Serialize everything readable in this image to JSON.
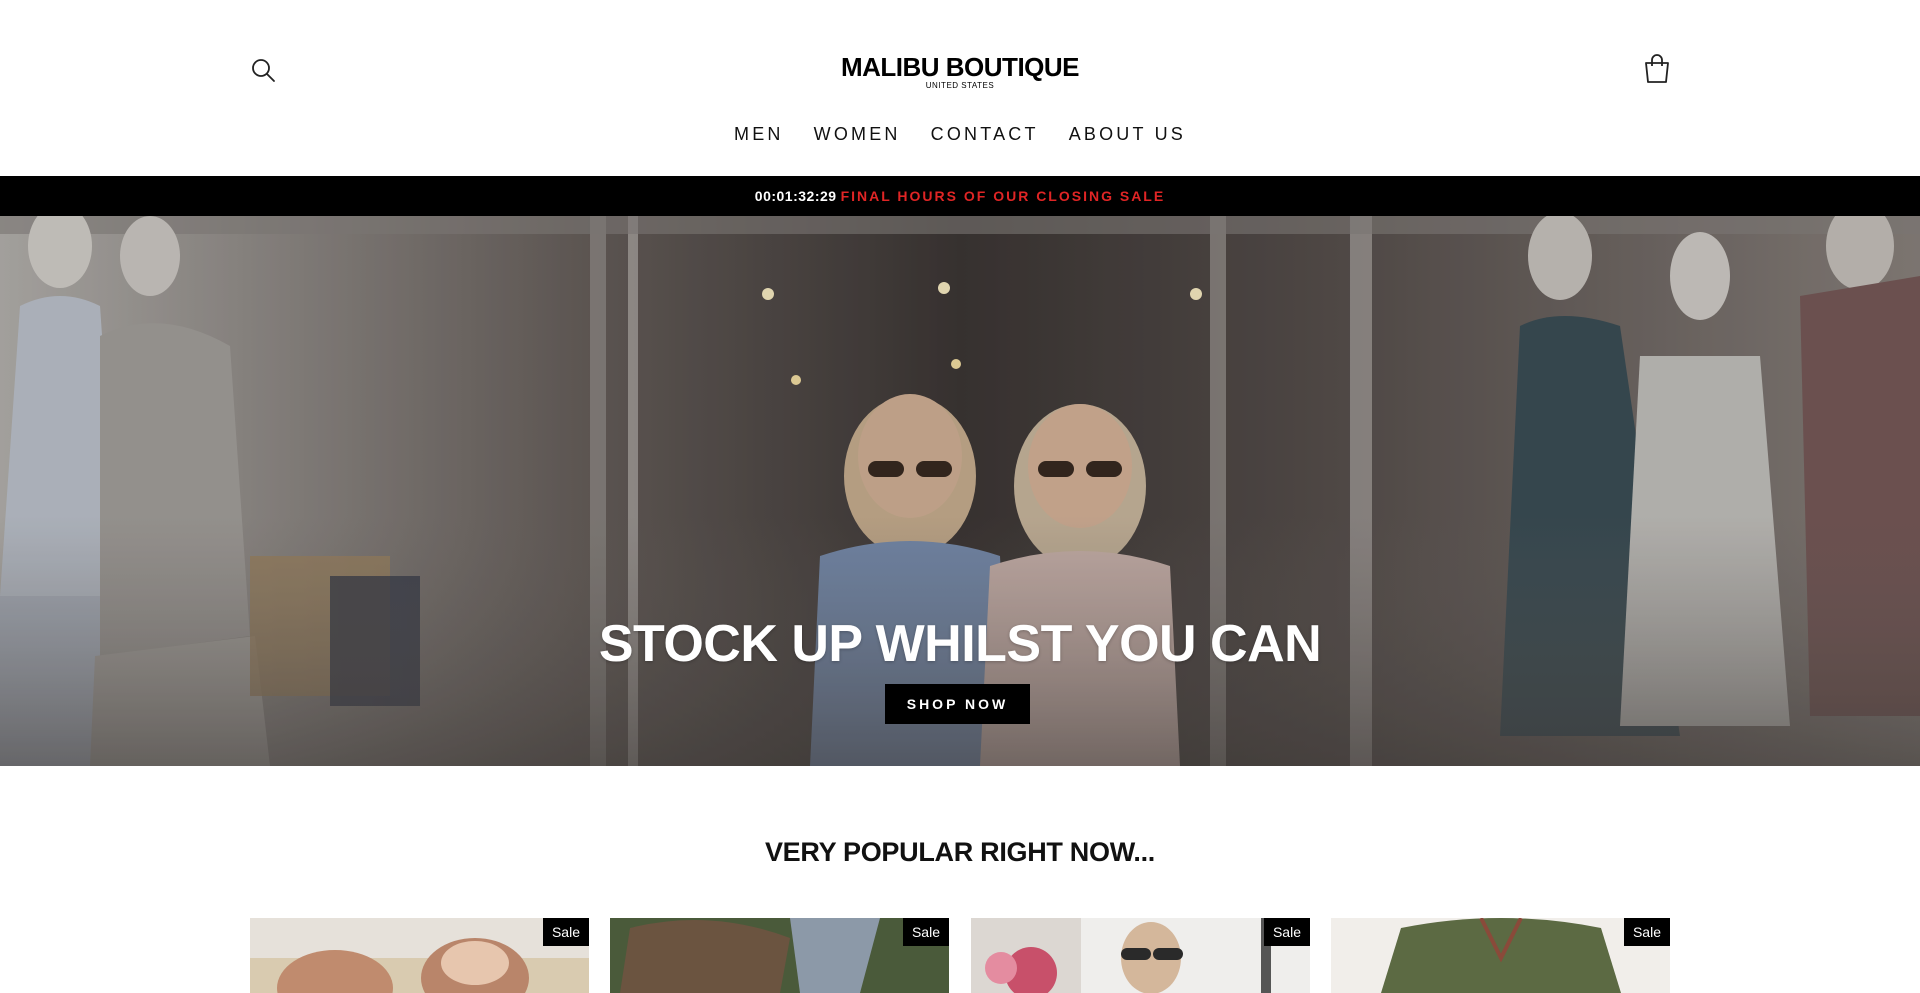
{
  "brand": {
    "name": "MALIBU BOUTIQUE",
    "subtitle": "UNITED STATES"
  },
  "nav": {
    "items": [
      "MEN",
      "WOMEN",
      "CONTACT",
      "ABOUT US"
    ]
  },
  "icons": {
    "search": "search-icon",
    "cart": "cart-icon"
  },
  "announcement": {
    "countdown": "00:01:32:29",
    "message": "FINAL HOURS OF OUR CLOSING SALE",
    "message_color": "#e02525",
    "background": "#000000"
  },
  "hero": {
    "title": "STOCK UP WHILST YOU CAN",
    "cta_label": "SHOP NOW"
  },
  "popular": {
    "title": "VERY POPULAR RIGHT NOW...",
    "products": [
      {
        "badge": "Sale"
      },
      {
        "badge": "Sale"
      },
      {
        "badge": "Sale"
      },
      {
        "badge": "Sale"
      }
    ]
  }
}
